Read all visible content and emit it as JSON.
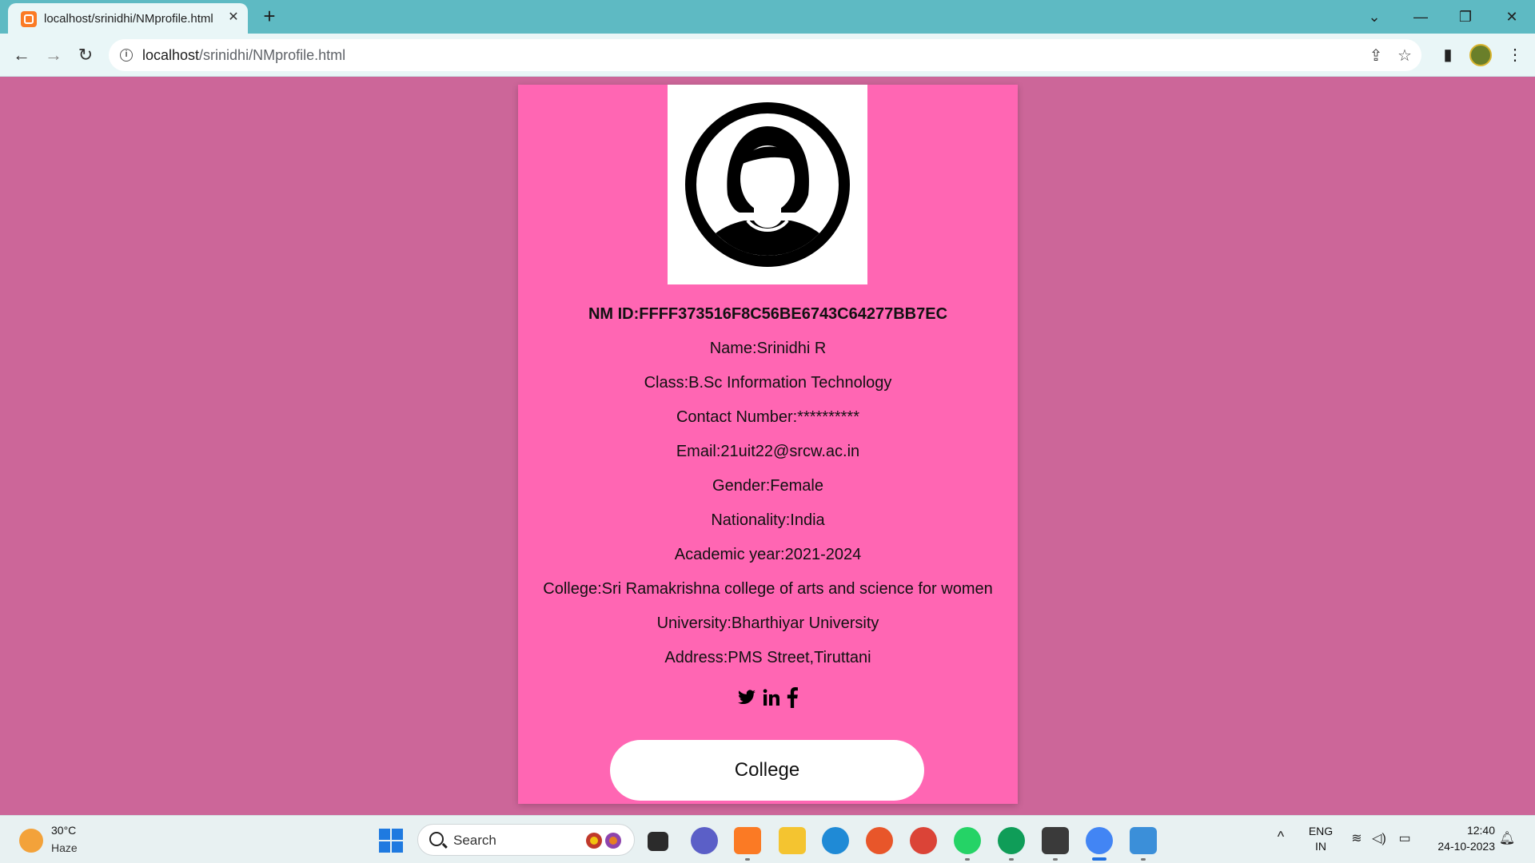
{
  "browser": {
    "tab_title": "localhost/srinidhi/NMprofile.html",
    "tab_close": "✕",
    "new_tab": "+",
    "url_host": "localhost",
    "url_path": "/srinidhi/NMprofile.html",
    "window_controls": {
      "tab_search": "⌄",
      "minimize": "—",
      "restore": "❐",
      "close": "✕"
    }
  },
  "profile": {
    "nm_id": "NM ID:FFFF373516F8C56BE6743C64277BB7EC",
    "name": "Name:Srinidhi R",
    "class": "Class:B.Sc Information Technology",
    "contact": "Contact Number:**********",
    "email": "Email:21uit22@srcw.ac.in",
    "gender": "Gender:Female",
    "nationality": "Nationality:India",
    "academic_year": "Academic year:2021-2024",
    "college": "College:Sri Ramakrishna college of arts and science for women",
    "university": "University:Bharthiyar University",
    "address": "Address:PMS Street,Tiruttani",
    "social_icons": [
      "twitter-icon",
      "linkedin-icon",
      "facebook-icon"
    ],
    "button_label": "College"
  },
  "taskbar": {
    "weather_temp": "30°C",
    "weather_desc": "Haze",
    "search_label": "Search",
    "lang_line1": "ENG",
    "lang_line2": "IN",
    "time": "12:40",
    "date": "24-10-2023"
  },
  "colors": {
    "page_background": "#cc6699",
    "card_background": "#ff66b3",
    "tab_strip": "#5ebac3",
    "button": "#ffffff"
  }
}
